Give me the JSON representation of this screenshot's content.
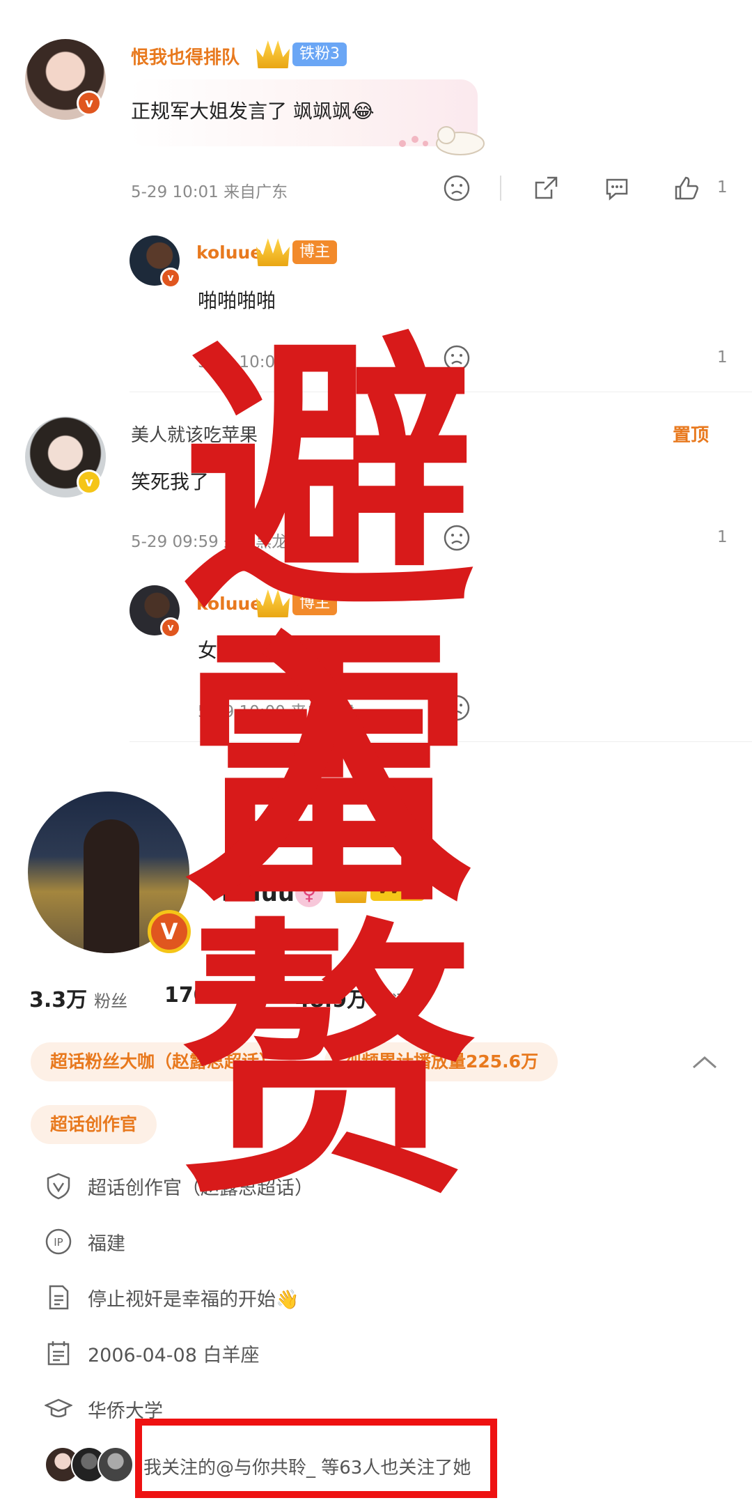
{
  "overlay": {
    "line1": "避雷",
    "line2": "入赘"
  },
  "comments": [
    {
      "username": "恨我也得排队",
      "fan_badge": "铁粉3",
      "text": "正规军大姐发言了 飒飒飒😂",
      "meta": "5-29 10:01 来自广东",
      "like_count": "1",
      "reply": {
        "username": "koluue",
        "badge": "博主",
        "text": "啪啪啪啪",
        "meta": "5-29 10:04 来自福建",
        "like_count": "1"
      }
    },
    {
      "username": "美人就该吃苹果",
      "top_tag": "置顶",
      "text": "笑死我了",
      "meta": "5-29 09:59 来自黑龙江",
      "like_count": "1",
      "reply": {
        "username": "koluue",
        "badge": "博主",
        "text": "女神来s l把",
        "meta": "5-29 10:00 来自福建"
      }
    }
  ],
  "profile": {
    "username": "koluue",
    "vvip_label": "VVIP",
    "stats": [
      {
        "num": "3.3万",
        "label": "粉丝"
      },
      {
        "num": "1708",
        "label": "关注"
      },
      {
        "num": "48.9万",
        "label": "转评赞"
      }
    ],
    "pills": [
      "超话粉丝大咖（赵露思超话）",
      "视频累计播放量225.6万",
      "超话创作官"
    ],
    "info": [
      {
        "icon": "shield-v-icon",
        "text": "超话创作官（赵露思超话）"
      },
      {
        "icon": "ip-icon",
        "text": "福建"
      },
      {
        "icon": "document-icon",
        "text": "停止视奸是幸福的开始👋"
      },
      {
        "icon": "calendar-icon",
        "text": "2006-04-08 白羊座"
      },
      {
        "icon": "graduation-cap-icon",
        "text": "华侨大学"
      }
    ],
    "followers_text": "我关注的@与你共聆_ 等63人也关注了她"
  },
  "colors": {
    "accent_red": "#d81a1a",
    "orange": "#e8791e",
    "pill_bg": "#fdf0e6"
  }
}
